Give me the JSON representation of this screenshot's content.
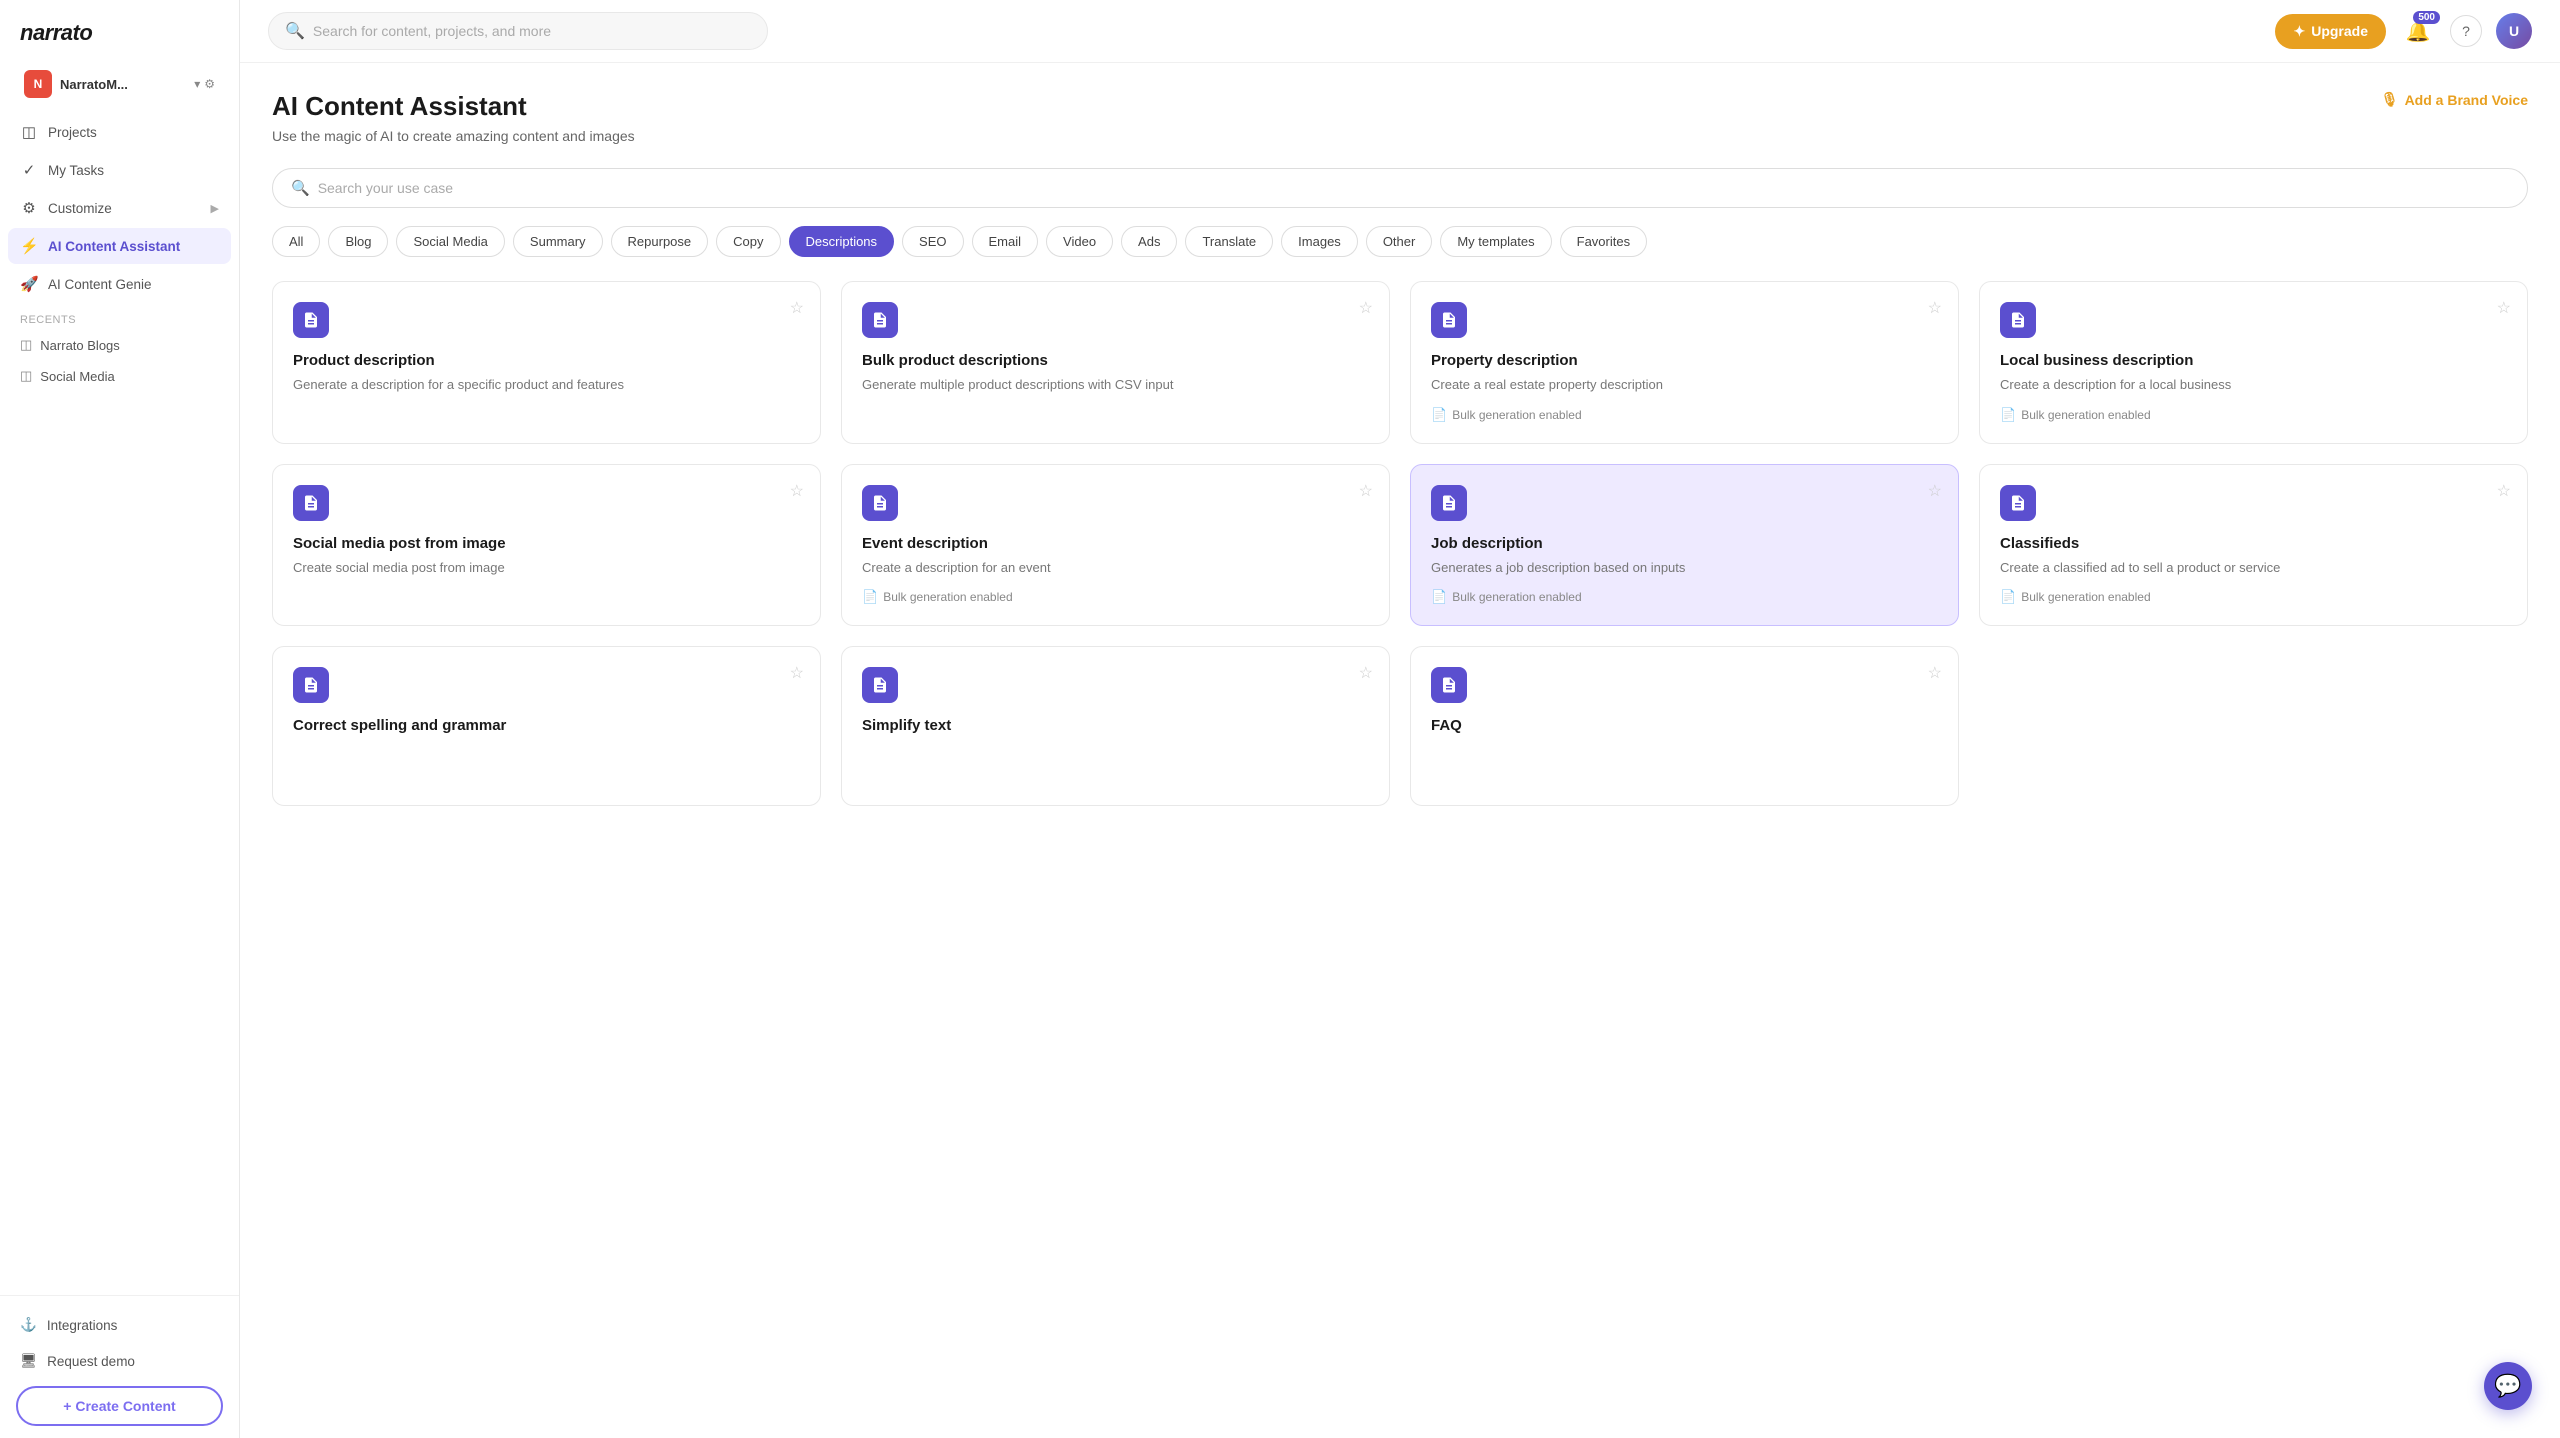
{
  "sidebar": {
    "logo": "narrato",
    "workspace": {
      "avatar_letter": "N",
      "name": "NarratoM..."
    },
    "nav_items": [
      {
        "id": "projects",
        "label": "Projects",
        "icon": "◫"
      },
      {
        "id": "my-tasks",
        "label": "My Tasks",
        "icon": "✓"
      },
      {
        "id": "customize",
        "label": "Customize",
        "icon": "⚙",
        "has_arrow": true
      },
      {
        "id": "ai-content-assistant",
        "label": "AI Content Assistant",
        "icon": "⚡",
        "active": true
      },
      {
        "id": "ai-content-genie",
        "label": "AI Content Genie",
        "icon": "🚀"
      }
    ],
    "recents_label": "Recents",
    "recents": [
      {
        "id": "narrato-blogs",
        "label": "Narrato Blogs"
      },
      {
        "id": "social-media",
        "label": "Social Media"
      }
    ],
    "bottom_items": [
      {
        "id": "integrations",
        "label": "Integrations",
        "icon": "⚓"
      },
      {
        "id": "request-demo",
        "label": "Request demo",
        "icon": "🖥"
      }
    ],
    "create_btn_label": "+ Create Content"
  },
  "topbar": {
    "search_placeholder": "Search for content, projects, and more",
    "upgrade_label": "Upgrade",
    "notif_count": "500",
    "help_label": "?"
  },
  "page": {
    "title": "AI Content Assistant",
    "subtitle": "Use the magic of AI to create amazing content and images",
    "brand_voice_label": "Add a Brand Voice"
  },
  "usecase_search": {
    "placeholder": "Search your use case"
  },
  "filters": [
    {
      "id": "all",
      "label": "All",
      "active": false
    },
    {
      "id": "blog",
      "label": "Blog",
      "active": false
    },
    {
      "id": "social-media",
      "label": "Social Media",
      "active": false
    },
    {
      "id": "summary",
      "label": "Summary",
      "active": false
    },
    {
      "id": "repurpose",
      "label": "Repurpose",
      "active": false
    },
    {
      "id": "copy",
      "label": "Copy",
      "active": false
    },
    {
      "id": "descriptions",
      "label": "Descriptions",
      "active": true
    },
    {
      "id": "seo",
      "label": "SEO",
      "active": false
    },
    {
      "id": "email",
      "label": "Email",
      "active": false
    },
    {
      "id": "video",
      "label": "Video",
      "active": false
    },
    {
      "id": "ads",
      "label": "Ads",
      "active": false
    },
    {
      "id": "translate",
      "label": "Translate",
      "active": false
    },
    {
      "id": "images",
      "label": "Images",
      "active": false
    },
    {
      "id": "other",
      "label": "Other",
      "active": false
    },
    {
      "id": "my-templates",
      "label": "My templates",
      "active": false
    },
    {
      "id": "favorites",
      "label": "Favorites",
      "active": false
    }
  ],
  "cards": [
    {
      "id": "product-description",
      "title": "Product description",
      "desc": "Generate a description for a specific product and features",
      "bulk": false,
      "highlighted": false
    },
    {
      "id": "bulk-product-descriptions",
      "title": "Bulk product descriptions",
      "desc": "Generate multiple product descriptions with CSV input",
      "bulk": false,
      "highlighted": false
    },
    {
      "id": "property-description",
      "title": "Property description",
      "desc": "Create a real estate property description",
      "bulk": true,
      "bulk_label": "Bulk generation enabled",
      "highlighted": false
    },
    {
      "id": "local-business-description",
      "title": "Local business description",
      "desc": "Create a description for a local business",
      "bulk": true,
      "bulk_label": "Bulk generation enabled",
      "highlighted": false
    },
    {
      "id": "social-media-post-from-image",
      "title": "Social media post from image",
      "desc": "Create social media post from image",
      "bulk": false,
      "highlighted": false
    },
    {
      "id": "event-description",
      "title": "Event description",
      "desc": "Create a description for an event",
      "bulk": true,
      "bulk_label": "Bulk generation enabled",
      "highlighted": false
    },
    {
      "id": "job-description",
      "title": "Job description",
      "desc": "Generates a job description based on inputs",
      "bulk": true,
      "bulk_label": "Bulk generation enabled",
      "highlighted": true
    },
    {
      "id": "classifieds",
      "title": "Classifieds",
      "desc": "Create a classified ad to sell a product or service",
      "bulk": true,
      "bulk_label": "Bulk generation enabled",
      "highlighted": false
    },
    {
      "id": "correct-spelling-grammar",
      "title": "Correct spelling and grammar",
      "desc": "",
      "bulk": false,
      "highlighted": false
    },
    {
      "id": "simplify-text",
      "title": "Simplify text",
      "desc": "",
      "bulk": false,
      "highlighted": false
    },
    {
      "id": "faq",
      "title": "FAQ",
      "desc": "",
      "bulk": false,
      "highlighted": false
    }
  ],
  "icons": {
    "search": "🔍",
    "star_empty": "☆",
    "star_filled": "★",
    "bulk": "📄",
    "upgrade_star": "✦",
    "bell": "🔔",
    "chat": "💬",
    "mic": "🎙",
    "anchor": "⚓"
  }
}
